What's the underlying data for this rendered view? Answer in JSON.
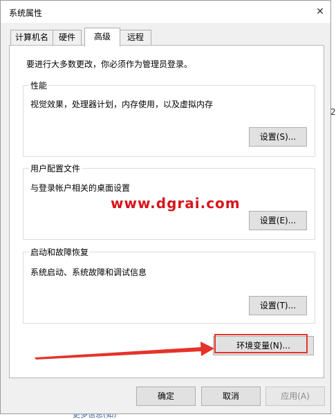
{
  "dialog": {
    "title": "系统属性",
    "close_icon": "close-icon"
  },
  "tabs": [
    {
      "label": "计算机名",
      "active": false
    },
    {
      "label": "硬件",
      "active": false
    },
    {
      "label": "高级",
      "active": true
    },
    {
      "label": "远程",
      "active": false
    }
  ],
  "advanced": {
    "intro": "要进行大多数更改，你必须作为管理员登录。",
    "performance": {
      "title": "性能",
      "description": "视觉效果，处理器计划，内存使用，以及虚拟内存",
      "button": "设置(S)..."
    },
    "user_profiles": {
      "title": "用户配置文件",
      "description": "与登录帐户相关的桌面设置",
      "button": "设置(E)..."
    },
    "startup_recovery": {
      "title": "启动和故障恢复",
      "description": "系统启动、系统故障和调试信息",
      "button": "设置(T)..."
    },
    "env_button": "环境变量(N)..."
  },
  "footer": {
    "ok": "确定",
    "cancel": "取消",
    "apply": "应用(A)"
  },
  "overlay": {
    "watermark": "www.dgrai.com",
    "highlight_color": "#e5332a"
  },
  "background": {
    "right_stub": "2",
    "bottom_text": "更多信息(如)"
  }
}
